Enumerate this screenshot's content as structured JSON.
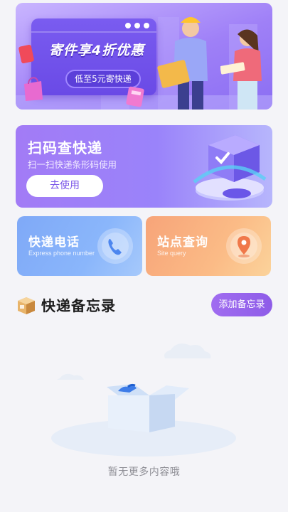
{
  "promo": {
    "title": "寄件享4折优惠",
    "pill": "低至5元寄快递"
  },
  "scan": {
    "title": "扫码查快递",
    "subtitle": "扫一扫快递条形码使用",
    "button": "去使用"
  },
  "services": [
    {
      "title": "快递电话",
      "subtitle": "Express phone number",
      "icon": "phone-icon"
    },
    {
      "title": "站点查询",
      "subtitle": "Site query",
      "icon": "location-pin-icon"
    }
  ],
  "memo": {
    "title": "快递备忘录",
    "add_button": "添加备忘录",
    "empty_text": "暂无更多内容哦"
  },
  "colors": {
    "accent_purple": "#8e5ce8",
    "phone_card": "#7fa9f7",
    "site_card": "#f7a479"
  }
}
